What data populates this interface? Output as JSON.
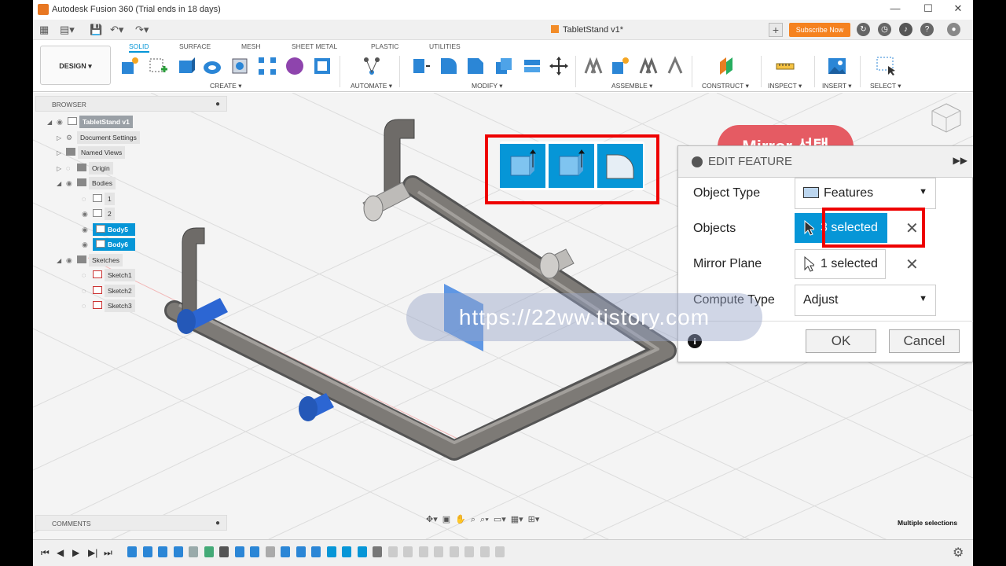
{
  "window": {
    "title": "Autodesk Fusion 360 (Trial ends in 18 days)",
    "doc_tab": "TabletStand v1*",
    "subscribe": "Subscribe Now"
  },
  "ribbon": {
    "workspace": "DESIGN ▾",
    "tabs": [
      "SOLID",
      "SURFACE",
      "MESH",
      "SHEET METAL",
      "PLASTIC",
      "UTILITIES"
    ],
    "groups": [
      "CREATE ▾",
      "AUTOMATE ▾",
      "MODIFY ▾",
      "ASSEMBLE ▾",
      "CONSTRUCT ▾",
      "INSPECT ▾",
      "INSERT ▾",
      "SELECT ▾"
    ]
  },
  "browser": {
    "title": "BROWSER",
    "items": [
      "TabletStand v1",
      "Document Settings",
      "Named Views",
      "Origin",
      "Bodies",
      "1",
      "2",
      "Body5",
      "Body6",
      "Sketches",
      "Sketch1",
      "Sketch2",
      "Sketch3"
    ],
    "comments": "COMMENTS"
  },
  "edit_feature": {
    "title": "EDIT FEATURE",
    "object_type_label": "Object Type",
    "object_type_value": "Features",
    "objects_label": "Objects",
    "objects_value": "3 selected",
    "mirror_plane_label": "Mirror Plane",
    "mirror_plane_value": "1 selected",
    "compute_type_label": "Compute Type",
    "compute_type_value": "Adjust",
    "ok": "OK",
    "cancel": "Cancel"
  },
  "annotation": {
    "label": "Mirror 선택",
    "watermark": "https://22ww.tistory.com"
  },
  "status": {
    "selection": "Multiple selections"
  },
  "colors": {
    "accent": "#0696d7",
    "highlight": "#e00000",
    "orange": "#f5821f"
  }
}
